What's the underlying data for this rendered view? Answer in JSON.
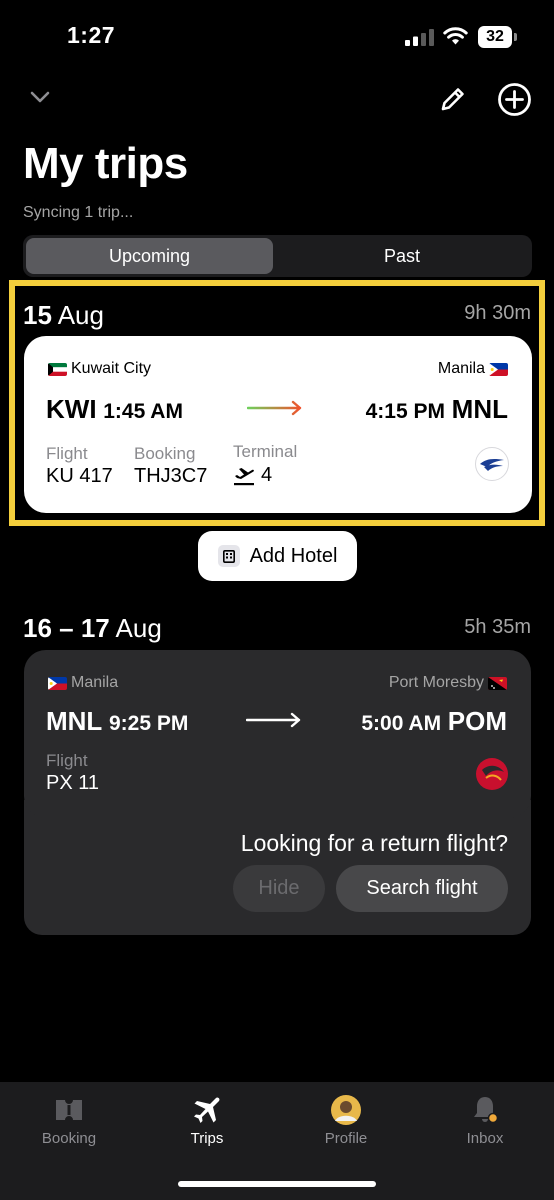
{
  "status_bar": {
    "time": "1:27",
    "battery": "32"
  },
  "header": {
    "title": "My trips",
    "sync_status": "Syncing 1 trip..."
  },
  "segments": {
    "upcoming": "Upcoming",
    "past": "Past",
    "selected": "Upcoming"
  },
  "trips": [
    {
      "date_day": "15",
      "date_month": "Aug",
      "duration": "9h 30m",
      "origin_city": "Kuwait City",
      "destination_city": "Manila",
      "origin_code": "KWI",
      "departure_time": "1:45 AM",
      "arrival_time": "4:15 PM",
      "destination_code": "MNL",
      "flight_label": "Flight",
      "flight": "KU 417",
      "booking_label": "Booking",
      "booking": "THJ3C7",
      "terminal_label": "Terminal",
      "terminal": "4",
      "airline_icon": "kuwait-airways-logo"
    },
    {
      "date_day": "16 – 17",
      "date_month": "Aug",
      "duration": "5h 35m",
      "origin_city": "Manila",
      "destination_city": "Port Moresby",
      "origin_code": "MNL",
      "departure_time": "9:25 PM",
      "arrival_time": "5:00 AM",
      "destination_code": "POM",
      "flight_label": "Flight",
      "flight": "PX 11",
      "airline_icon": "air-niugini-logo"
    }
  ],
  "add_hotel": {
    "label": "Add Hotel",
    "icon": "building-icon"
  },
  "return_prompt": {
    "question": "Looking for a return flight?",
    "hide": "Hide",
    "search": "Search flight"
  },
  "tab_bar": {
    "items": [
      {
        "label": "Booking",
        "icon": "ticket-icon"
      },
      {
        "label": "Trips",
        "icon": "airplane-icon",
        "active": true
      },
      {
        "label": "Profile",
        "icon": "avatar"
      },
      {
        "label": "Inbox",
        "icon": "bell-icon"
      }
    ]
  },
  "colors": {
    "highlight": "#f4cf3c",
    "card_light": "#ffffff",
    "card_dark": "#2a2a2c",
    "arrow_gradient_start": "#6fcf5c",
    "arrow_gradient_end": "#f0532e"
  }
}
